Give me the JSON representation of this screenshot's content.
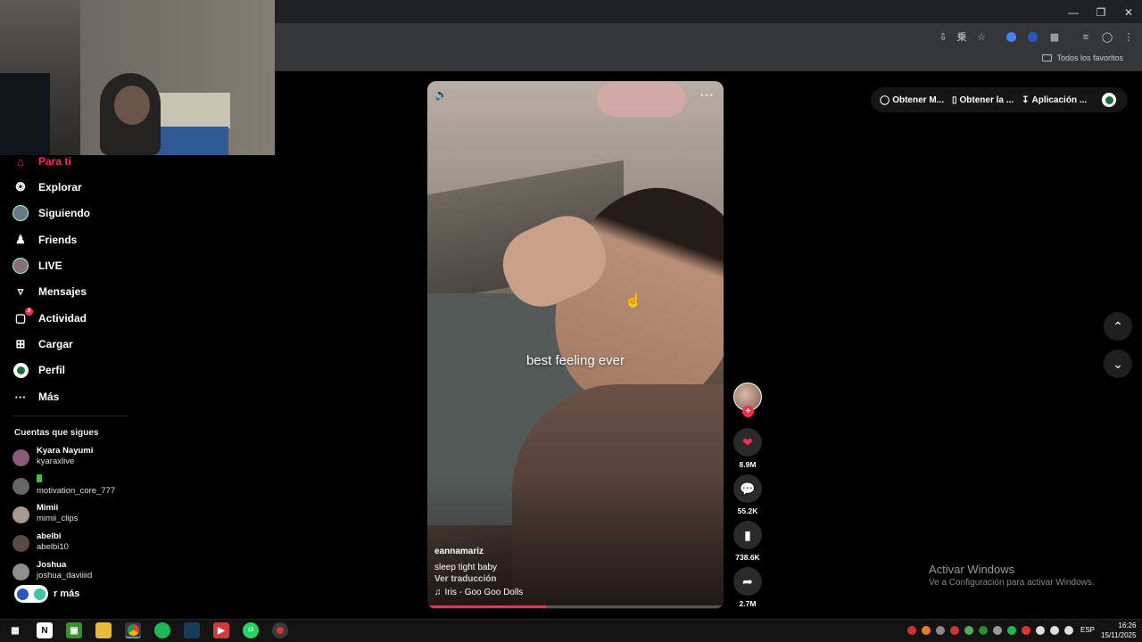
{
  "browser": {
    "bookmarks_folder": "Todos los favoritos",
    "window_controls": [
      "minimize-icon",
      "restore-icon",
      "close-icon"
    ],
    "toolbar_icons": [
      "install-icon",
      "translate-icon",
      "star-icon",
      "extension-icon",
      "extension-icon",
      "puzzle-icon",
      "media-icon",
      "profile-icon",
      "menu-icon"
    ]
  },
  "sidebar": {
    "items": [
      {
        "label": "Para ti",
        "icon": "home-icon",
        "active": true
      },
      {
        "label": "Explorar",
        "icon": "compass-icon"
      },
      {
        "label": "Siguiendo",
        "icon": "avatar-icon"
      },
      {
        "label": "Friends",
        "icon": "friends-icon"
      },
      {
        "label": "LIVE",
        "icon": "live-avatar-icon"
      },
      {
        "label": "Mensajes",
        "icon": "send-icon"
      },
      {
        "label": "Actividad",
        "icon": "activity-icon",
        "badge": "9"
      },
      {
        "label": "Cargar",
        "icon": "plus-square-icon"
      },
      {
        "label": "Perfil",
        "icon": "profile-avatar-icon"
      },
      {
        "label": "Más",
        "icon": "dots-icon"
      }
    ],
    "following_title": "Cuentas que sigues",
    "following": [
      {
        "name": "Kyara Nayumi",
        "handle": "kyaraxlive"
      },
      {
        "name": "",
        "handle": "motivation_core_777"
      },
      {
        "name": "Mimii",
        "handle": "mimii_clips"
      },
      {
        "name": "abelbi",
        "handle": "abelbi10"
      },
      {
        "name": "Joshua",
        "handle": "joshua_daviiiid"
      }
    ],
    "see_more": "r más"
  },
  "video": {
    "overlay_text": "best feeling ever",
    "username": "eannamariz",
    "description": "sleep tight baby",
    "translate": "Ver traducción",
    "music": "Iris - Goo Goo Dolls",
    "progress": 0.4
  },
  "actions": {
    "likes": "8.9M",
    "comments": "55.2K",
    "saves": "738.6K",
    "shares": "2.7M"
  },
  "topbar": {
    "get_coins": "Obtener M...",
    "get_app": "Obtener la ...",
    "app": "Aplicación ..."
  },
  "watermark": {
    "title": "Activar Windows",
    "subtitle": "Ve a Configuración para activar Windows."
  },
  "taskbar": {
    "lang": "ESP",
    "time": "16:26",
    "date": "15/11/2025",
    "whatsapp_badge": "12"
  },
  "colors": {
    "accent": "#fe2c55",
    "background": "#000000",
    "chrome": "#35363a"
  }
}
